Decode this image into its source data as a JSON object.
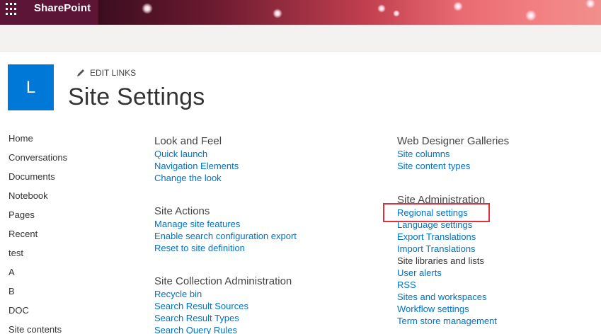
{
  "suite_bar": {
    "brand": "SharePoint"
  },
  "site_header": {
    "logo_letter": "L",
    "edit_links": "EDIT LINKS",
    "page_title": "Site Settings"
  },
  "left_nav": [
    "Home",
    "Conversations",
    "Documents",
    "Notebook",
    "Pages",
    "Recent",
    "test",
    "A",
    "B",
    "DOC",
    "Site contents"
  ],
  "columns": {
    "left": [
      {
        "title": "Look and Feel",
        "links": [
          "Quick launch",
          "Navigation Elements",
          "Change the look"
        ]
      },
      {
        "title": "Site Actions",
        "links": [
          "Manage site features",
          "Enable search configuration export",
          "Reset to site definition"
        ]
      },
      {
        "title": "Site Collection Administration",
        "links": [
          "Recycle bin",
          "Search Result Sources",
          "Search Result Types",
          "Search Query Rules"
        ]
      }
    ],
    "right": [
      {
        "title": "Web Designer Galleries",
        "links": [
          "Site columns",
          "Site content types"
        ]
      },
      {
        "title": "Site Administration",
        "links": [
          "Regional settings",
          "Language settings",
          "Export Translations",
          "Import Translations",
          "Site libraries and lists",
          "User alerts",
          "RSS",
          "Sites and workspaces",
          "Workflow settings",
          "Term store management"
        ]
      }
    ]
  },
  "colors": {
    "link": "#0072c6",
    "logo_bg": "#0078d7",
    "highlight": "#d9343f"
  }
}
